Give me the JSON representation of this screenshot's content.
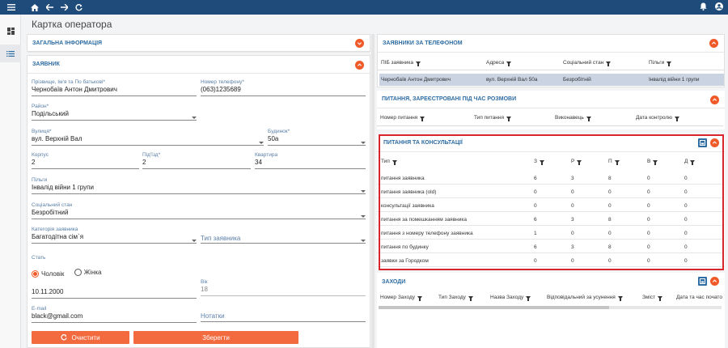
{
  "colors": {
    "topbar": "#1e4b7a",
    "accent": "#f05a28",
    "heading": "#2e6da4",
    "highlight": "#d9262c"
  },
  "topbar": {
    "icons": [
      "menu-icon",
      "home-icon",
      "arrow-left-icon",
      "arrow-right-icon",
      "refresh-icon",
      "bell-icon",
      "account-icon"
    ]
  },
  "page": {
    "title": "Картка оператора"
  },
  "left": {
    "general": {
      "title": "ЗАГАЛЬНА ІНФОРМАЦІЯ"
    },
    "applicant": {
      "title": "ЗАЯВНИК",
      "full_name": {
        "label": "Прізвище, Ім'я та По батькові*",
        "value": "Чернобаїв Антон Дмитрович"
      },
      "phone": {
        "label": "Номер телефону*",
        "value": "(063)1235689"
      },
      "district": {
        "label": "Район*",
        "value": "Подільський"
      },
      "street": {
        "label": "Вулиця*",
        "value": "вул. Верхній Вал"
      },
      "building": {
        "label": "Будинок*",
        "value": "50а"
      },
      "korpus": {
        "label": "Корпус",
        "value": "2"
      },
      "entrance": {
        "label": "Під'їзд*",
        "value": "2"
      },
      "apartment": {
        "label": "Квартира",
        "value": "34"
      },
      "benefits": {
        "label": "Пільги",
        "value": "Інвалід війни 1 групи"
      },
      "social": {
        "label": "Соціальний стан",
        "value": "Безробітний"
      },
      "category": {
        "label": "Категорія заявника",
        "value": "Багатодітна сім`я"
      },
      "applicant_type": {
        "placeholder": "Тип заявника"
      },
      "sex": {
        "label": "Стать",
        "male": "Чоловік",
        "female": "Жінка"
      },
      "birth_date": {
        "value": "10.11.2000"
      },
      "age": {
        "label": "Вік",
        "value": "18"
      },
      "email": {
        "label": "E-mail",
        "value": "black@gmail.com"
      },
      "notes": {
        "placeholder": "Нотатки"
      },
      "clear_label": "Очистити",
      "save_label": "Зберегти"
    }
  },
  "right": {
    "phone_applicants": {
      "title": "ЗАЯВНИКИ ЗА ТЕЛЕФОНОМ",
      "columns": [
        "ПІБ заявника",
        "Адреса",
        "Соціальний стан",
        "Пільги"
      ],
      "rows": [
        [
          "Чернобаїв Антон Дмитрович",
          "вул. Верхній Вал 50а",
          "Безробітній",
          "Інвалід війни 1 групи"
        ]
      ]
    },
    "questions_registered": {
      "title": "ПИТАННЯ, ЗАРЕЄСТРОВАНІ ПІД ЧАС РОЗМОВИ",
      "columns": [
        "Номер питання",
        "Тип питання",
        "Виконавець",
        "Дата контролю"
      ]
    },
    "consultations": {
      "title": "ПИТАННЯ ТА КОНСУЛЬТАЦІЇ",
      "columns": [
        "Тип",
        "З",
        "Р",
        "П",
        "В",
        "Д"
      ],
      "rows": [
        [
          "питання заявника",
          "6",
          "3",
          "8",
          "0",
          "0"
        ],
        [
          "питання заявника (old)",
          "0",
          "0",
          "0",
          "0",
          "0"
        ],
        [
          "консультації заявника",
          "0",
          "0",
          "0",
          "0",
          "0"
        ],
        [
          "питання за помешканням заявника",
          "6",
          "3",
          "8",
          "0",
          "0"
        ],
        [
          "питання з номеру телефону заявника",
          "1",
          "0",
          "0",
          "0",
          "0"
        ],
        [
          "питання по будинку",
          "6",
          "3",
          "8",
          "0",
          "0"
        ],
        [
          "заявки за Городком",
          "0",
          "0",
          "0",
          "0",
          "0"
        ]
      ]
    },
    "events": {
      "title": "ЗАХОДИ",
      "columns": [
        "Номер Заходу",
        "Тип Заходу",
        "Назва Заходу",
        "Відповідальний за усунення",
        "Зміст",
        "Дата та час почато"
      ]
    }
  }
}
